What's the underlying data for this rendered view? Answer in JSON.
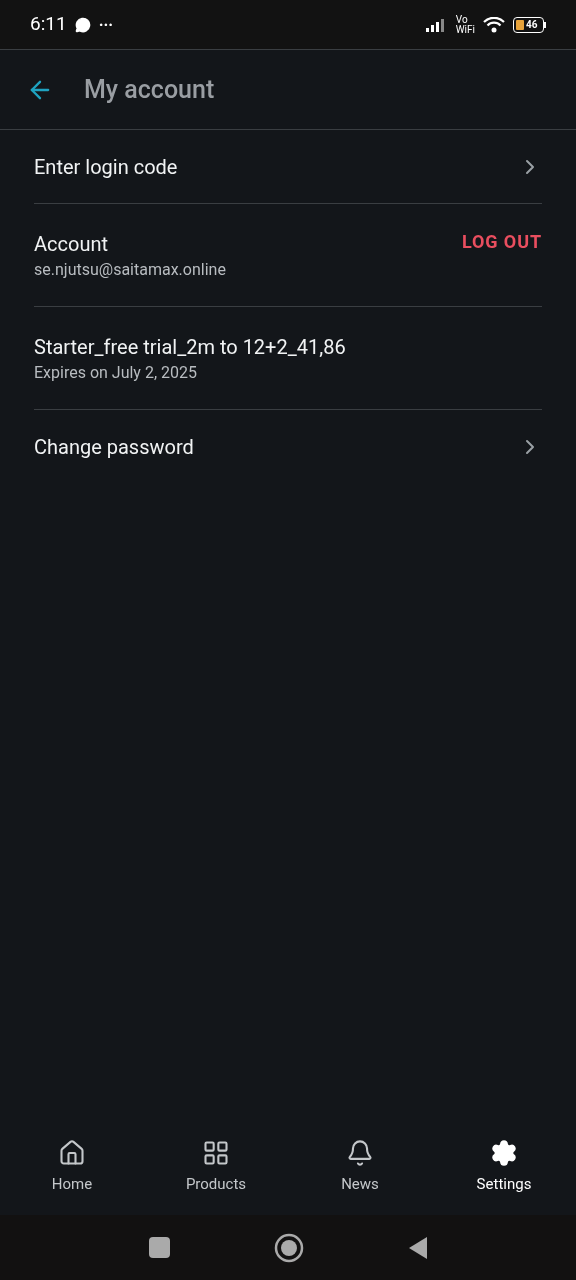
{
  "status_bar": {
    "time": "6:11",
    "more": "···",
    "vo_wifi": [
      "Vo",
      "WiFi"
    ],
    "battery": "46"
  },
  "header": {
    "title": "My account"
  },
  "items": [
    {
      "kind": "link",
      "title": "Enter login code"
    },
    {
      "kind": "account",
      "title": "Account",
      "subtitle": "se.njutsu@saitamax.online",
      "action": "LOG OUT"
    },
    {
      "kind": "info",
      "title": "Starter_free trial_2m to 12+2_41,86",
      "subtitle": "Expires on July 2, 2025"
    },
    {
      "kind": "link",
      "title": "Change password"
    }
  ],
  "bottom_nav": [
    {
      "label": "Home",
      "selected": false
    },
    {
      "label": "Products",
      "selected": false
    },
    {
      "label": "News",
      "selected": false
    },
    {
      "label": "Settings",
      "selected": true
    }
  ]
}
